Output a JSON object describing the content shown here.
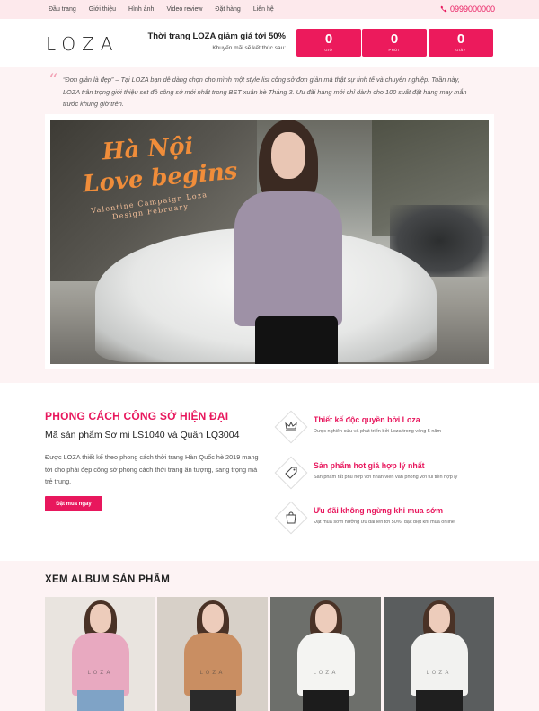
{
  "nav": {
    "items": [
      "Đầu trang",
      "Giới thiệu",
      "Hình ảnh",
      "Video review",
      "Đặt hàng",
      "Liên hệ"
    ],
    "phone": "0999000000"
  },
  "header": {
    "logo": "LOZA",
    "promo_title": "Thời trang LOZA giảm giá tới 50%",
    "promo_sub": "Khuyến mãi sẽ kết thúc sau:",
    "countdown": [
      {
        "value": "0",
        "label": "GIỜ"
      },
      {
        "value": "0",
        "label": "PHÚT"
      },
      {
        "value": "0",
        "label": "GIÂY"
      }
    ]
  },
  "intro": {
    "text": "“Đơn giản là đẹp” – Tại LOZA bạn dễ dàng chọn cho mình một style list công sở đơn giản mà thật sự tinh tế và chuyên nghiệp. Tuần này, LOZA trân trọng giới thiệu set đồ công sở mới nhất trong BST xuân hè Tháng 3. Ưu đãi hàng mới chỉ dành cho 100 suất đặt hàng may mắn trước khung giờ trên.",
    "hero_line1": "Hà Nội",
    "hero_line2": "Love begins",
    "hero_sub": "Valentine Campaign Loza Design February"
  },
  "feature": {
    "heading": "PHONG CÁCH CÔNG SỞ HIỆN ĐẠI",
    "subheading": "Mã sản phẩm Sơ mi LS1040 và Quần LQ3004",
    "description": "Được LOZA thiết kế theo phong cách thời trang Hàn Quốc hè 2019 mang tới cho phái đẹp công sở phong cách thời trang ẩn tượng, sang trọng mà trẻ trung.",
    "cta": "Đặt mua ngay",
    "bullets": [
      {
        "icon": "crown-icon",
        "title": "Thiết kế độc quyền bởi Loza",
        "desc": "Được nghiên cứu và phát triển bởi Loza trong vòng 5 năm"
      },
      {
        "icon": "tag-icon",
        "title": "Sản phẩm hot giá hợp lý nhất",
        "desc": "Sản phẩm rất phù hợp với nhân viên văn phòng với túi tiền hợp lý"
      },
      {
        "icon": "shopping-bag-icon",
        "title": "Ưu đãi không ngừng khi mua sớm",
        "desc": "Đặt mua sớm hưởng ưu đãi lên tới 50%, đặc biệt khi mua online"
      }
    ]
  },
  "album": {
    "heading": "XEM ALBUM SẢN PHẨM",
    "watermark": "LOZA",
    "photos": [
      {
        "bg": "#e9e4df",
        "top": "#e8a9c0",
        "bottom": "#7fa3c6"
      },
      {
        "bg": "#d7d0c8",
        "top": "#c98e62",
        "bottom": "#2a2a2a"
      },
      {
        "bg": "#6d6f6b",
        "top": "#f4f4f2",
        "bottom": "#1c1c1c"
      },
      {
        "bg": "#5a5d5e",
        "top": "#f2f2f0",
        "bottom": "#1f1f1f"
      }
    ]
  },
  "colors": {
    "accent": "#e8175d",
    "soft_bg": "#fdf3f4",
    "nav_bg": "#fde9ec"
  }
}
